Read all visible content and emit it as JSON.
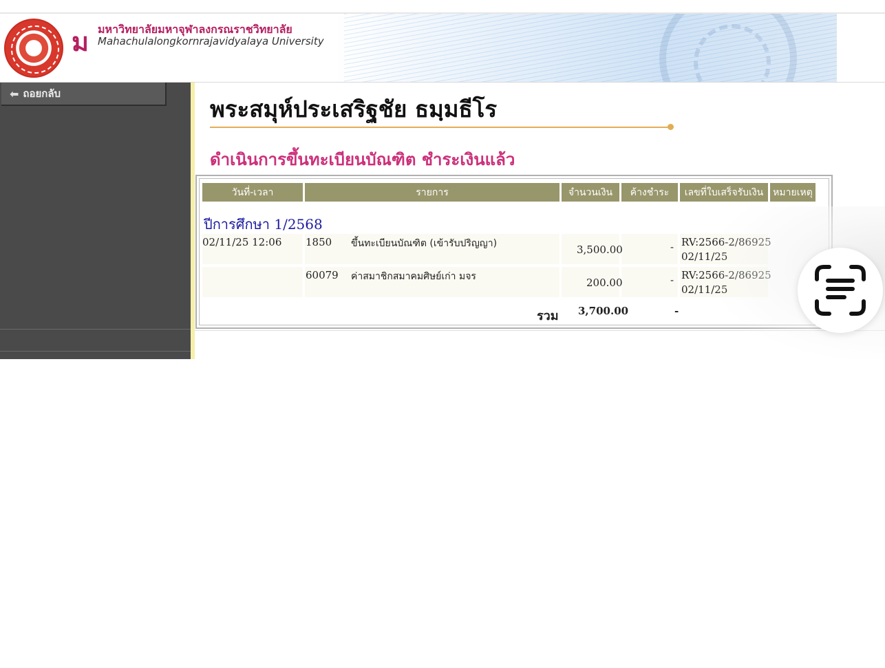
{
  "header": {
    "university_thai": "มหาวิทยาลัยมหาจุฬาลงกรณราชวิทยาลัย",
    "university_en": "Mahachulalongkornrajavidyalaya University"
  },
  "sidebar": {
    "back_label": "ถอยกลับ"
  },
  "student_name": "พระสมุห์ประเสริฐชัย ธมฺมธีโร",
  "status_heading": "ดำเนินการขึ้นทะเบียนบัณฑิต ชำระเงินแล้ว",
  "table": {
    "headers": [
      "วันที่-เวลา",
      "รายการ",
      "จำนวนเงิน",
      "ค้างชำระ",
      "เลขที่ใบเสร็จรับเงิน",
      "หมายเหตุ"
    ],
    "year_label": "ปีการศึกษา 1/2568",
    "rows": [
      {
        "datetime": "02/11/25 12:06",
        "code": "1850",
        "item": "ขึ้นทะเบียนบัณฑิต (เข้ารับปริญญา)",
        "amount": "3,500.00",
        "outstanding": "-",
        "receipt_no": "RV:2566-2/86925",
        "receipt_date": "02/11/25"
      },
      {
        "datetime": "",
        "code": "60079",
        "item": "ค่าสมาชิกสมาคมศิษย์เก่า มจร",
        "amount": "200.00",
        "outstanding": "-",
        "receipt_no": "RV:2566-2/86925",
        "receipt_date": "02/11/25"
      }
    ],
    "total_label": "รวม",
    "total_amount": "3,700.00",
    "total_outstanding": "-"
  },
  "colors": {
    "accent_pink": "#cc2f7a",
    "header_olive": "#98966b",
    "year_blue": "#1c1aa0",
    "sidebar_gray": "#4a4a4a"
  },
  "icons": {
    "scan": "text-scan-icon",
    "back": "arrow-left-icon",
    "seal": "university-seal-icon"
  }
}
